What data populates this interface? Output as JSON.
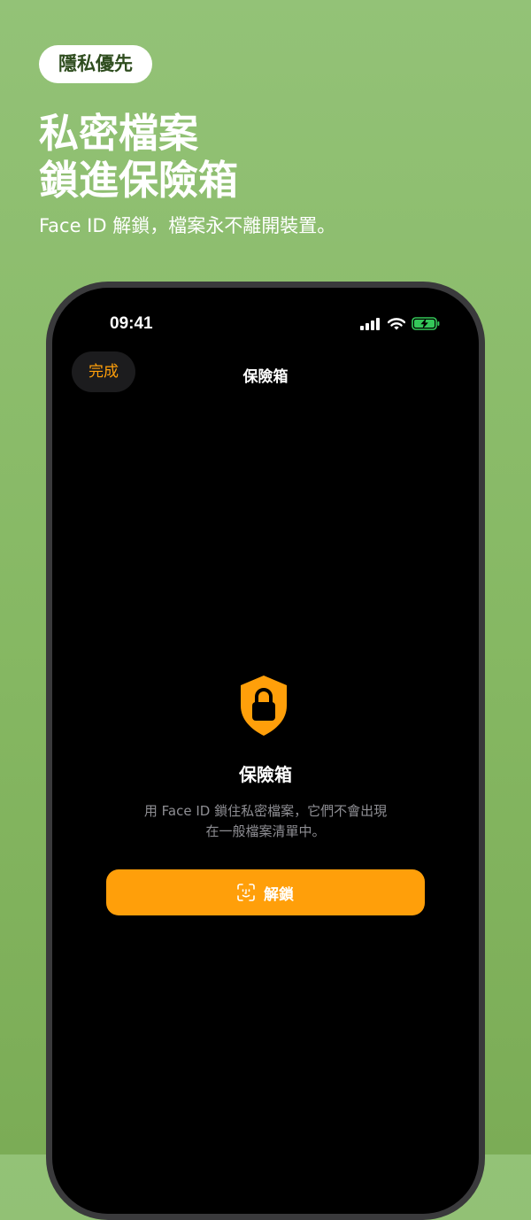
{
  "badge": {
    "label": "隱私優先"
  },
  "headline": {
    "line1": "私密檔案",
    "line2": "鎖進保險箱"
  },
  "subline": "Face ID 解鎖，檔案永不離開裝置。",
  "phone": {
    "status_bar": {
      "time": "09:41",
      "icons": [
        "cellular-signal-icon",
        "wifi-icon",
        "battery-charging-icon"
      ]
    },
    "nav": {
      "done_label": "完成",
      "title": "保險箱"
    },
    "vault": {
      "icon": "lock-shield-icon",
      "title": "保險箱",
      "description_line1": "用 Face ID 鎖住私密檔案，它們不會出現",
      "description_line2": "在一般檔案清單中。",
      "unlock_icon": "face-id-icon",
      "unlock_label": "解鎖"
    }
  },
  "colors": {
    "background": "#8bbd6c",
    "accent": "#ff9f0a",
    "screen": "#000000",
    "battery": "#34c759"
  }
}
